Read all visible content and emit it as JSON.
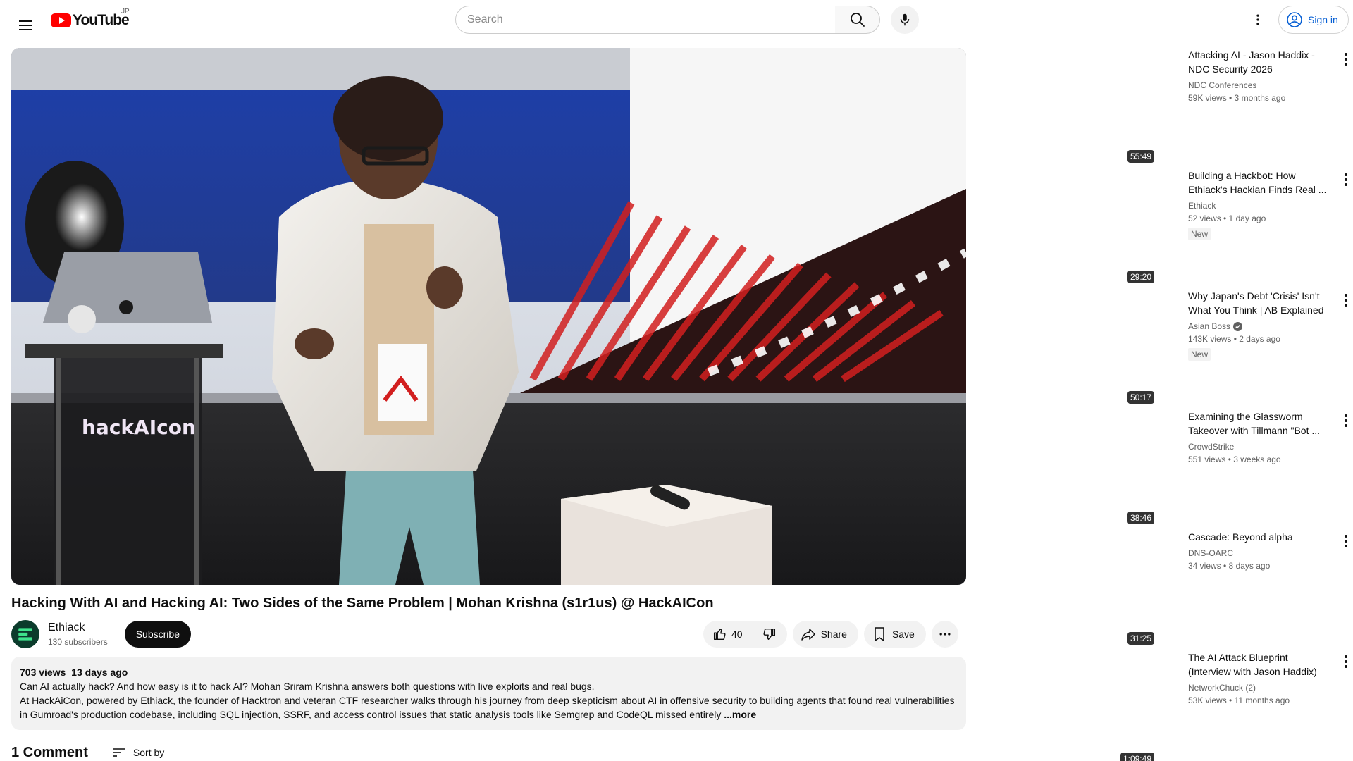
{
  "header": {
    "logo_text": "YouTube",
    "region": "JP",
    "search_placeholder": "Search",
    "signin_label": "Sign in"
  },
  "video": {
    "title": "Hacking With AI and Hacking AI: Two Sides of the Same Problem | Mohan Krishna (s1r1us) @ HackAICon",
    "stage_sign": "hackAIcon"
  },
  "channel": {
    "name": "Ethiack",
    "subscribers": "130 subscribers",
    "subscribe_label": "Subscribe"
  },
  "actions": {
    "like_count": "40",
    "share_label": "Share",
    "save_label": "Save"
  },
  "description": {
    "views": "703 views",
    "date": "13 days ago",
    "line1": "Can AI actually hack? And how easy is it to hack AI? Mohan Sriram Krishna answers both questions with live exploits and real bugs.",
    "line2": "At HackAiCon, powered by Ethiack, the founder of Hacktron and veteran CTF researcher walks through his journey from deep skepticism about AI in offensive security to building agents that found real vulnerabilities",
    "line3": "in Gumroad's production codebase, including SQL injection, SSRF, and access control issues that static analysis tools like Semgrep and CodeQL missed entirely",
    "more_label": "...more"
  },
  "comments": {
    "count_label": "1 Comment",
    "sort_label": "Sort by"
  },
  "recommendations": [
    {
      "title": "Attacking AI - Jason Haddix - NDC Security 2026",
      "channel": "NDC Conferences",
      "verified": false,
      "stats": "59K views • 3 months ago",
      "badge": "",
      "duration": "55:49"
    },
    {
      "title": "Building a Hackbot: How Ethiack's Hackian Finds Real ...",
      "channel": "Ethiack",
      "verified": false,
      "stats": "52 views • 1 day ago",
      "badge": "New",
      "duration": "29:20"
    },
    {
      "title": "Why Japan's Debt 'Crisis' Isn't What You Think | AB Explained",
      "channel": "Asian Boss",
      "verified": true,
      "stats": "143K views • 2 days ago",
      "badge": "New",
      "duration": "50:17"
    },
    {
      "title": "Examining the Glassworm Takeover with Tillmann \"Bot ...",
      "channel": "CrowdStrike",
      "verified": false,
      "stats": "551 views • 3 weeks ago",
      "badge": "",
      "duration": "38:46"
    },
    {
      "title": "Cascade: Beyond alpha",
      "channel": "DNS-OARC",
      "verified": false,
      "stats": "34 views • 8 days ago",
      "badge": "",
      "duration": "31:25"
    },
    {
      "title": "The AI Attack Blueprint (Interview with Jason Haddix)",
      "channel": "NetworkChuck (2)",
      "verified": false,
      "stats": "53K views • 11 months ago",
      "badge": "",
      "duration": "1:09:49"
    }
  ],
  "colors": {
    "brand_red": "#ff0000",
    "link_blue": "#065fd4",
    "text_primary": "#0f0f0f",
    "text_secondary": "#606060",
    "chip_bg": "#f2f2f2"
  }
}
